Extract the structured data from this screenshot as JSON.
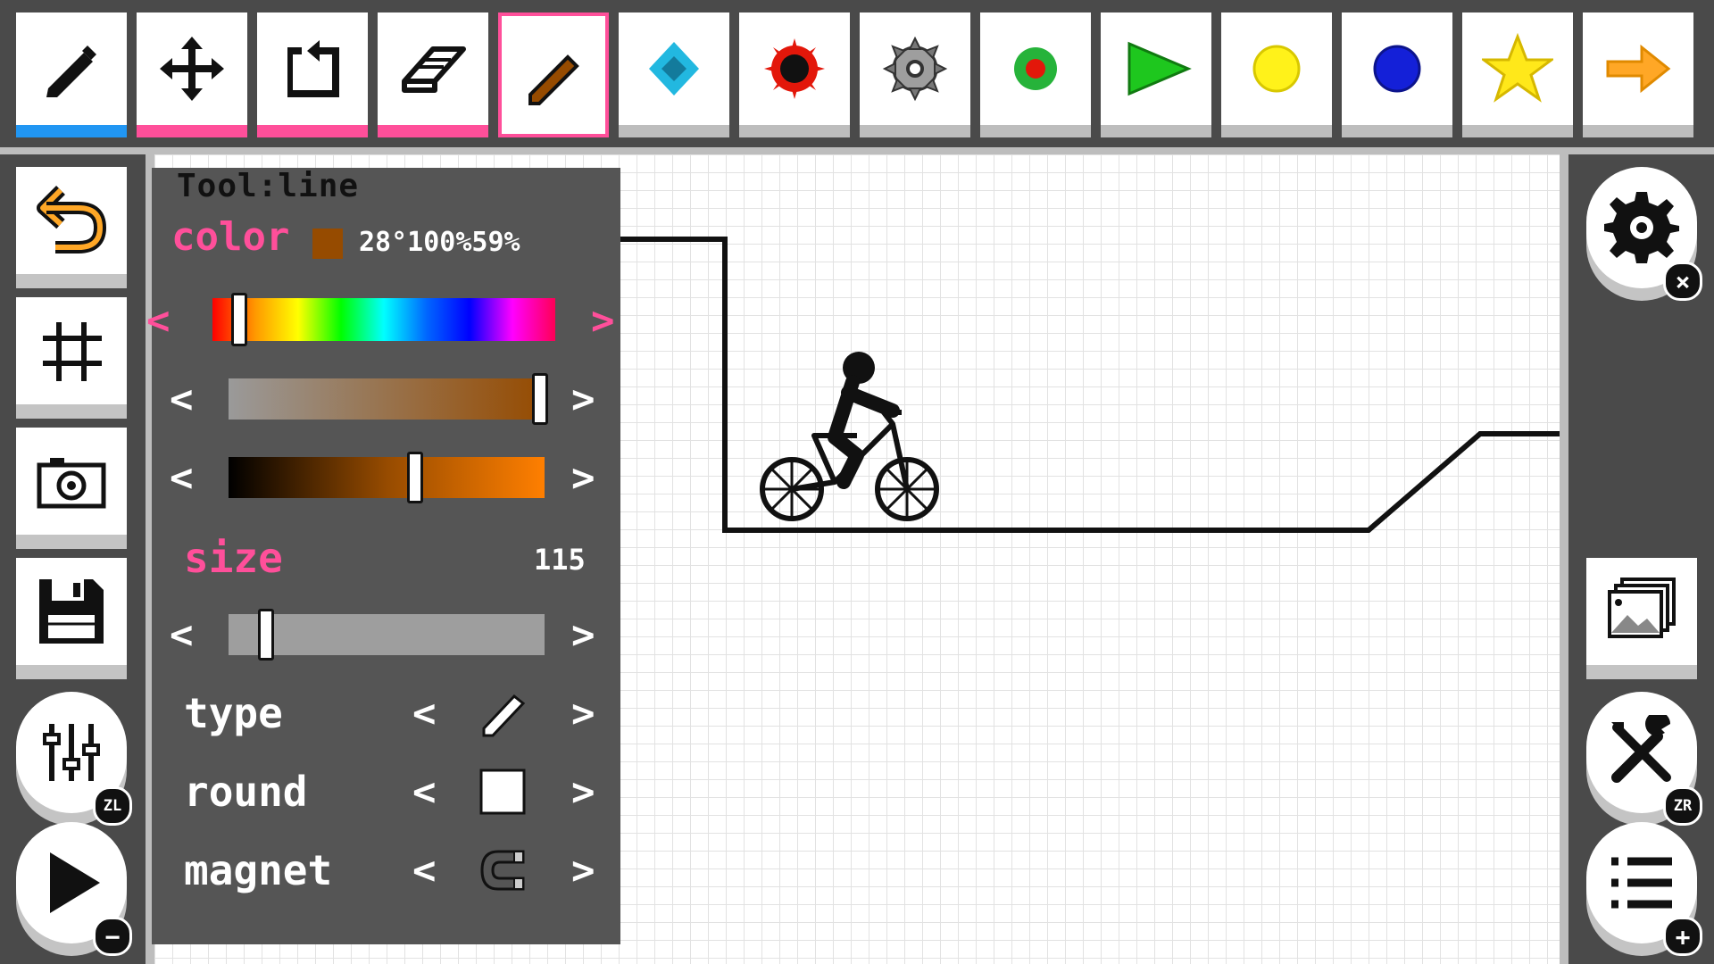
{
  "toolbar": {
    "tools": [
      {
        "name": "line",
        "icon": "pencil-line-icon",
        "state": "blue"
      },
      {
        "name": "move",
        "icon": "move-arrows-icon",
        "state": "pink"
      },
      {
        "name": "rotate",
        "icon": "rotate-icon",
        "state": "pink"
      },
      {
        "name": "eraser",
        "icon": "eraser-icon",
        "state": "pink"
      },
      {
        "name": "brown-line",
        "icon": "brown-line-icon",
        "state": "selected"
      },
      {
        "name": "diamond",
        "icon": "diamond-icon",
        "state": "none"
      },
      {
        "name": "mine",
        "icon": "mine-icon",
        "state": "none"
      },
      {
        "name": "saw",
        "icon": "saw-gear-icon",
        "state": "none"
      },
      {
        "name": "target",
        "icon": "target-icon",
        "state": "none"
      },
      {
        "name": "flag",
        "icon": "flag-icon",
        "state": "none"
      },
      {
        "name": "yellow-ball",
        "icon": "yellow-circle-icon",
        "state": "none"
      },
      {
        "name": "blue-ball",
        "icon": "blue-circle-icon",
        "state": "none"
      },
      {
        "name": "star",
        "icon": "star-icon",
        "state": "none"
      },
      {
        "name": "arrow",
        "icon": "arrow-right-icon",
        "state": "none"
      }
    ]
  },
  "left_buttons": [
    {
      "name": "undo",
      "icon": "undo-icon"
    },
    {
      "name": "grid",
      "icon": "grid-icon"
    },
    {
      "name": "camera",
      "icon": "camera-icon"
    },
    {
      "name": "save",
      "icon": "save-icon"
    },
    {
      "name": "mixer",
      "icon": "sliders-icon",
      "badge": "ZL"
    },
    {
      "name": "play",
      "icon": "play-icon",
      "badge": "−"
    }
  ],
  "right_buttons": [
    {
      "name": "settings",
      "icon": "gear-icon",
      "badge": "×"
    },
    {
      "name": "gallery",
      "icon": "gallery-icon"
    },
    {
      "name": "tools",
      "icon": "wrench-screwdriver-icon",
      "badge": "ZR"
    },
    {
      "name": "menu",
      "icon": "menu-list-icon",
      "badge": "+"
    }
  ],
  "panel": {
    "tool_label": "Tool:line",
    "color_label": "color",
    "color_readout": "28°100%59%",
    "hue_percent": 7.8,
    "saturation_percent": 100,
    "lightness_percent": 59,
    "size_label": "size",
    "size_value": "115",
    "size_percent": 12,
    "type_label": "type",
    "round_label": "round",
    "magnet_label": "magnet",
    "arrow_left": "<",
    "arrow_right": ">"
  },
  "colors": {
    "accent_pink": "#ff4f9a",
    "accent_blue": "#2196f3",
    "current_color": "#964b00",
    "panel_bg": "#555555",
    "frame_bg": "#4a4a4a"
  }
}
